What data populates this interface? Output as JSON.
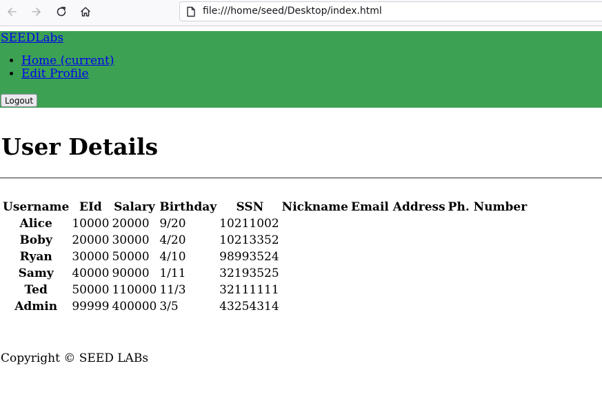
{
  "browser": {
    "url": "file:///home/seed/Desktop/index.html",
    "icons": [
      "back-arrow-icon",
      "forward-arrow-icon",
      "reload-icon",
      "home-icon",
      "file-page-icon"
    ]
  },
  "navbar": {
    "brand": "SEEDLabs",
    "links": [
      {
        "label": "Home (current)"
      },
      {
        "label": "Edit Profile"
      }
    ],
    "logout_label": "Logout",
    "background_color": "#3da153",
    "link_color": "#0000ee"
  },
  "main": {
    "title": "User Details",
    "table": {
      "headers": [
        "Username",
        "EId",
        "Salary",
        "Birthday",
        "SSN",
        "Nickname",
        "Email Address",
        "Ph. Number"
      ],
      "rows": [
        [
          "Alice",
          "10000",
          "20000",
          "9/20",
          "10211002",
          "",
          "",
          ""
        ],
        [
          "Boby",
          "20000",
          "30000",
          "4/20",
          "10213352",
          "",
          "",
          ""
        ],
        [
          "Ryan",
          "30000",
          "50000",
          "4/10",
          "98993524",
          "",
          "",
          ""
        ],
        [
          "Samy",
          "40000",
          "90000",
          "1/11",
          "32193525",
          "",
          "",
          ""
        ],
        [
          "Ted",
          "50000",
          "110000",
          "11/3",
          "32111111",
          "",
          "",
          ""
        ],
        [
          "Admin",
          "99999",
          "400000",
          "3/5",
          "43254314",
          "",
          "",
          ""
        ]
      ]
    }
  },
  "footer": {
    "text": "Copyright © SEED LABs"
  }
}
